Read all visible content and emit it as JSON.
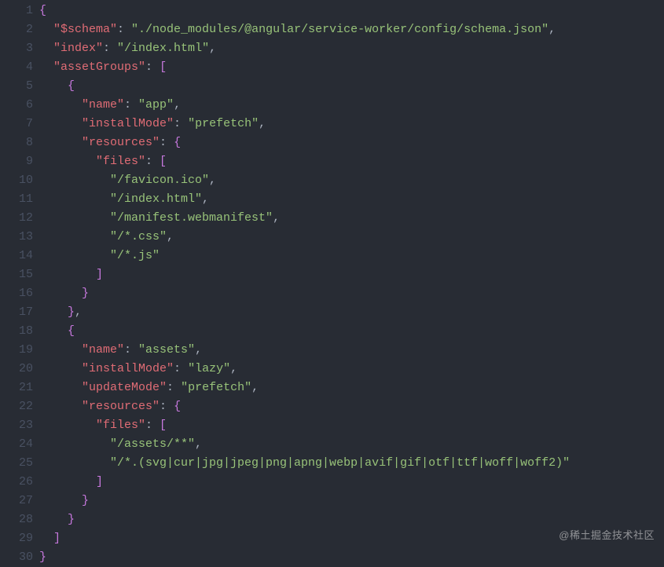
{
  "watermark": "@稀土掘金技术社区",
  "json_content": {
    "$schema": "./node_modules/@angular/service-worker/config/schema.json",
    "index": "/index.html",
    "assetGroups": [
      {
        "name": "app",
        "installMode": "prefetch",
        "resources": {
          "files": [
            "/favicon.ico",
            "/index.html",
            "/manifest.webmanifest",
            "/*.css",
            "/*.js"
          ]
        }
      },
      {
        "name": "assets",
        "installMode": "lazy",
        "updateMode": "prefetch",
        "resources": {
          "files": [
            "/assets/**",
            "/*.(svg|cur|jpg|jpeg|png|apng|webp|avif|gif|otf|ttf|woff|woff2)"
          ]
        }
      }
    ]
  },
  "lines": [
    [
      [
        "br",
        "{"
      ]
    ],
    [
      [
        "p",
        "  "
      ],
      [
        "key",
        "\"$schema\""
      ],
      [
        "p",
        ": "
      ],
      [
        "str",
        "\"./node_modules/@angular/service-worker/config/schema.json\""
      ],
      [
        "p",
        ","
      ]
    ],
    [
      [
        "p",
        "  "
      ],
      [
        "key",
        "\"index\""
      ],
      [
        "p",
        ": "
      ],
      [
        "str",
        "\"/index.html\""
      ],
      [
        "p",
        ","
      ]
    ],
    [
      [
        "p",
        "  "
      ],
      [
        "key",
        "\"assetGroups\""
      ],
      [
        "p",
        ": "
      ],
      [
        "br",
        "["
      ]
    ],
    [
      [
        "p",
        "    "
      ],
      [
        "br",
        "{"
      ]
    ],
    [
      [
        "p",
        "      "
      ],
      [
        "key",
        "\"name\""
      ],
      [
        "p",
        ": "
      ],
      [
        "str",
        "\"app\""
      ],
      [
        "p",
        ","
      ]
    ],
    [
      [
        "p",
        "      "
      ],
      [
        "key",
        "\"installMode\""
      ],
      [
        "p",
        ": "
      ],
      [
        "str",
        "\"prefetch\""
      ],
      [
        "p",
        ","
      ]
    ],
    [
      [
        "p",
        "      "
      ],
      [
        "key",
        "\"resources\""
      ],
      [
        "p",
        ": "
      ],
      [
        "br",
        "{"
      ]
    ],
    [
      [
        "p",
        "        "
      ],
      [
        "key",
        "\"files\""
      ],
      [
        "p",
        ": "
      ],
      [
        "br",
        "["
      ]
    ],
    [
      [
        "p",
        "          "
      ],
      [
        "str",
        "\"/favicon.ico\""
      ],
      [
        "p",
        ","
      ]
    ],
    [
      [
        "p",
        "          "
      ],
      [
        "str",
        "\"/index.html\""
      ],
      [
        "p",
        ","
      ]
    ],
    [
      [
        "p",
        "          "
      ],
      [
        "str",
        "\"/manifest.webmanifest\""
      ],
      [
        "p",
        ","
      ]
    ],
    [
      [
        "p",
        "          "
      ],
      [
        "str",
        "\"/*.css\""
      ],
      [
        "p",
        ","
      ]
    ],
    [
      [
        "p",
        "          "
      ],
      [
        "str",
        "\"/*.js\""
      ]
    ],
    [
      [
        "p",
        "        "
      ],
      [
        "br",
        "]"
      ]
    ],
    [
      [
        "p",
        "      "
      ],
      [
        "br",
        "}"
      ]
    ],
    [
      [
        "p",
        "    "
      ],
      [
        "br",
        "}"
      ],
      [
        "p",
        ","
      ]
    ],
    [
      [
        "p",
        "    "
      ],
      [
        "br",
        "{"
      ]
    ],
    [
      [
        "p",
        "      "
      ],
      [
        "key",
        "\"name\""
      ],
      [
        "p",
        ": "
      ],
      [
        "str",
        "\"assets\""
      ],
      [
        "p",
        ","
      ]
    ],
    [
      [
        "p",
        "      "
      ],
      [
        "key",
        "\"installMode\""
      ],
      [
        "p",
        ": "
      ],
      [
        "str",
        "\"lazy\""
      ],
      [
        "p",
        ","
      ]
    ],
    [
      [
        "p",
        "      "
      ],
      [
        "key",
        "\"updateMode\""
      ],
      [
        "p",
        ": "
      ],
      [
        "str",
        "\"prefetch\""
      ],
      [
        "p",
        ","
      ]
    ],
    [
      [
        "p",
        "      "
      ],
      [
        "key",
        "\"resources\""
      ],
      [
        "p",
        ": "
      ],
      [
        "br",
        "{"
      ]
    ],
    [
      [
        "p",
        "        "
      ],
      [
        "key",
        "\"files\""
      ],
      [
        "p",
        ": "
      ],
      [
        "br",
        "["
      ]
    ],
    [
      [
        "p",
        "          "
      ],
      [
        "str",
        "\"/assets/**\""
      ],
      [
        "p",
        ","
      ]
    ],
    [
      [
        "p",
        "          "
      ],
      [
        "str",
        "\"/*.(svg|cur|jpg|jpeg|png|apng|webp|avif|gif|otf|ttf|woff|woff2)\""
      ]
    ],
    [
      [
        "p",
        "        "
      ],
      [
        "br",
        "]"
      ]
    ],
    [
      [
        "p",
        "      "
      ],
      [
        "br",
        "}"
      ]
    ],
    [
      [
        "p",
        "    "
      ],
      [
        "br",
        "}"
      ]
    ],
    [
      [
        "p",
        "  "
      ],
      [
        "br",
        "]"
      ]
    ],
    [
      [
        "br",
        "}"
      ]
    ]
  ]
}
